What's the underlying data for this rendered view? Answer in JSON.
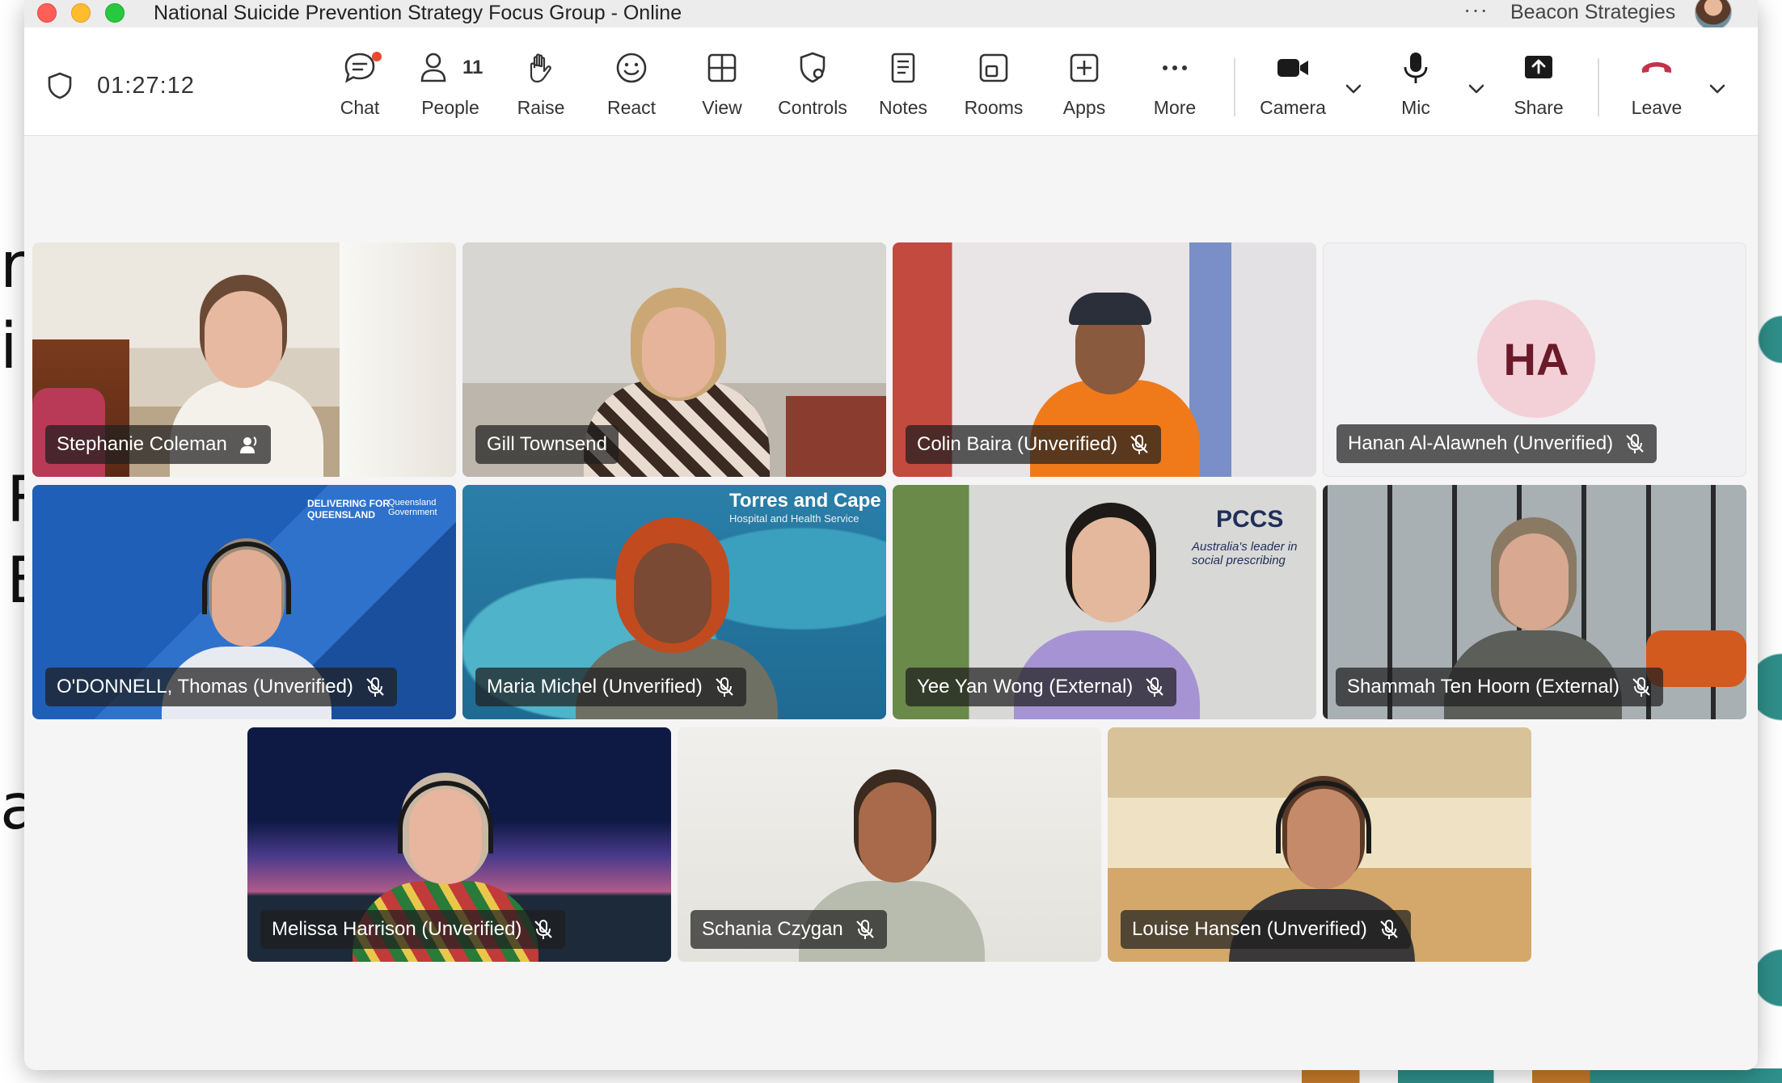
{
  "window": {
    "title": "National Suicide Prevention Strategy Focus Group - Online",
    "org_name": "Beacon Strategies",
    "more_glyph": "···"
  },
  "toolbar": {
    "timer": "01:27:12",
    "people_count": "11",
    "buttons": [
      {
        "id": "chat",
        "label": "Chat"
      },
      {
        "id": "people",
        "label": "People"
      },
      {
        "id": "raise",
        "label": "Raise"
      },
      {
        "id": "react",
        "label": "React"
      },
      {
        "id": "view",
        "label": "View"
      },
      {
        "id": "controls",
        "label": "Controls"
      },
      {
        "id": "notes",
        "label": "Notes"
      },
      {
        "id": "rooms",
        "label": "Rooms"
      },
      {
        "id": "apps",
        "label": "Apps"
      },
      {
        "id": "more",
        "label": "More"
      },
      {
        "id": "camera",
        "label": "Camera"
      },
      {
        "id": "mic",
        "label": "Mic"
      },
      {
        "id": "share",
        "label": "Share"
      },
      {
        "id": "leave",
        "label": "Leave"
      }
    ]
  },
  "participants": [
    {
      "name": "Stephanie Coleman",
      "status": "speaking",
      "active": false
    },
    {
      "name": "Gill Townsend",
      "status": "none",
      "active": true
    },
    {
      "name": "Colin Baira (Unverified)",
      "status": "muted",
      "active": false
    },
    {
      "name": "Hanan Al-Alawneh (Unverified)",
      "status": "muted",
      "active": false,
      "initials": "HA"
    },
    {
      "name": "O'DONNELL, Thomas (Unverified)",
      "status": "muted",
      "active": false
    },
    {
      "name": "Maria Michel (Unverified)",
      "status": "muted",
      "active": false
    },
    {
      "name": "Yee Yan Wong (External)",
      "status": "muted",
      "active": false
    },
    {
      "name": "Shammah Ten Hoorn (External)",
      "status": "muted",
      "active": false
    },
    {
      "name": "Melissa Harrison (Unverified)",
      "status": "muted",
      "active": false
    },
    {
      "name": "Schania Czygan",
      "status": "muted",
      "active": false
    },
    {
      "name": "Louise Hansen (Unverified)",
      "status": "muted",
      "active": false
    }
  ],
  "backgrounds": {
    "torres": "Torres and Cape",
    "torres_sub": "Hospital and Health Service",
    "pccs": "PCCS",
    "pccs_tag": "Australia's leader in social prescribing",
    "qld": "DELIVERING FOR QUEENSLAND",
    "qld_gov": "Queensland Government"
  },
  "colors": {
    "accent": "#5b5fc7",
    "leave": "#c4314b",
    "badge": "#e84a2f"
  }
}
